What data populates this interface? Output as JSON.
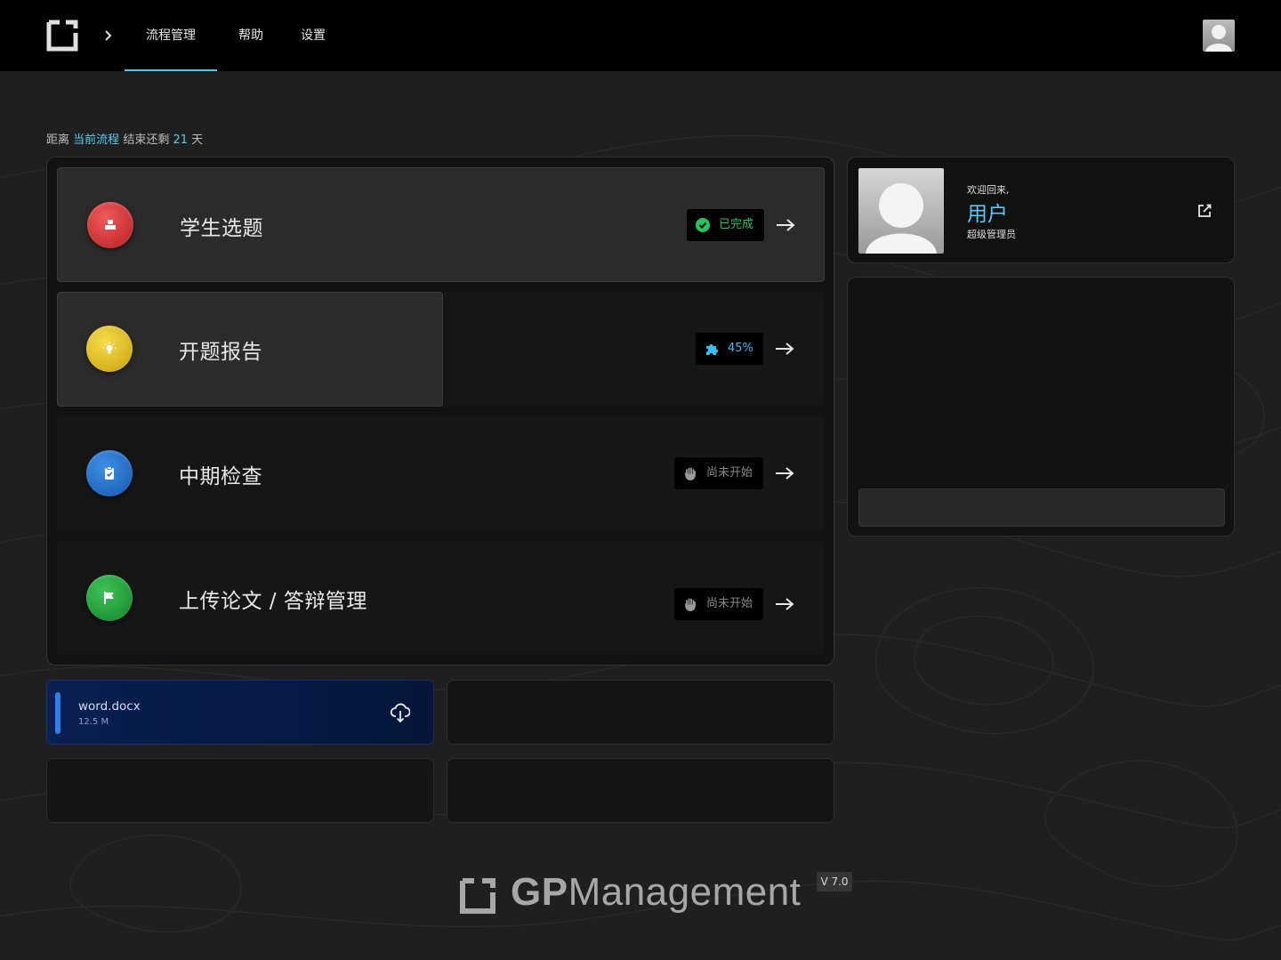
{
  "nav": {
    "links": [
      "流程管理",
      "帮助",
      "设置"
    ],
    "active_index": 0
  },
  "countdown": {
    "prefix": "距离",
    "target": "当前流程",
    "middle": "结束还剩",
    "days": "21",
    "suffix": "天"
  },
  "steps": [
    {
      "title": "学生选题",
      "status": "已完成",
      "status_color": "#22c55e",
      "icon": "stamp-icon",
      "icon_color": "#d9383a"
    },
    {
      "title": "开题报告",
      "status": "45%",
      "status_color": "#38bdf8",
      "progress": 0.45,
      "icon": "lightbulb-icon",
      "icon_color": "#e6c21f"
    },
    {
      "title": "中期检查",
      "status": "尚未开始",
      "status_color": "#8a8a8a",
      "icon": "clipboard-check-icon",
      "icon_color": "#1f6fd1"
    },
    {
      "title": "上传论文 / 答辩管理",
      "status": "尚未开始",
      "status_color": "#8a8a8a",
      "icon": "flag-icon",
      "icon_color": "#22a63a"
    }
  ],
  "file": {
    "name": "word.docx",
    "size": "12.5 M"
  },
  "user": {
    "welcome": "欢迎回来,",
    "name": "用户",
    "role": "超级管理员"
  },
  "footer": {
    "brand_prefix": "GP",
    "brand_suffix": "Management",
    "version": "V 7.0"
  },
  "colors": {
    "accent": "#5ec8ec",
    "background": "#1f1f1f"
  }
}
